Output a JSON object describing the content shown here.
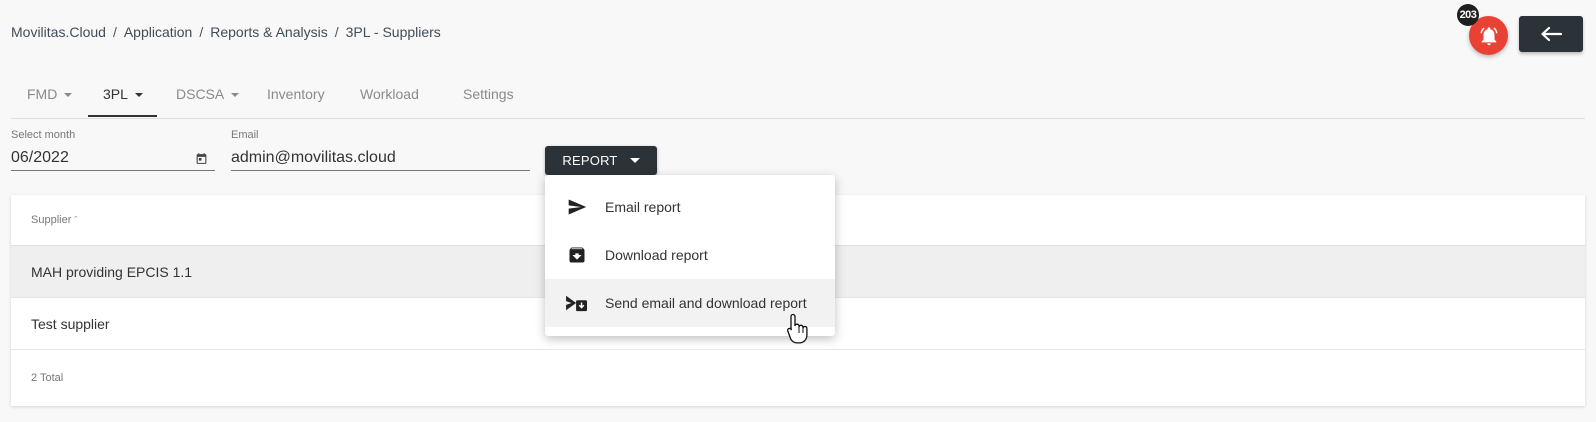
{
  "breadcrumb": [
    "Movilitas.Cloud",
    "Application",
    "Reports & Analysis",
    "3PL - Suppliers"
  ],
  "notifications": {
    "count": "203",
    "icon": "bell-icon",
    "color": "#e94235"
  },
  "back_button": {
    "icon": "arrow-left-icon"
  },
  "tabs": [
    {
      "label": "FMD",
      "dropdown": true
    },
    {
      "label": "3PL",
      "dropdown": true,
      "active": true
    },
    {
      "label": "DSCSA",
      "dropdown": true
    },
    {
      "label": "Inventory"
    },
    {
      "label": "Workload"
    },
    {
      "label": "Settings"
    }
  ],
  "month_field": {
    "label": "Select month",
    "value": "06/2022",
    "icon": "calendar-icon"
  },
  "email_field": {
    "label": "Email",
    "value": "admin@movilitas.cloud"
  },
  "report_button": {
    "label": "REPORT"
  },
  "report_menu": [
    {
      "label": "Email report",
      "icon": "send-icon"
    },
    {
      "label": "Download report",
      "icon": "archive-download-icon"
    },
    {
      "label": "Send email and download report",
      "icon": "send-download-icon",
      "hovered": true
    }
  ],
  "table": {
    "column_header": "Supplier",
    "sort_indicator": "^",
    "rows": [
      "MAH providing EPCIS 1.1",
      "Test supplier"
    ],
    "total": "2 Total"
  },
  "colors": {
    "dark_button": "#2c3338",
    "background": "#f8f8f8"
  }
}
